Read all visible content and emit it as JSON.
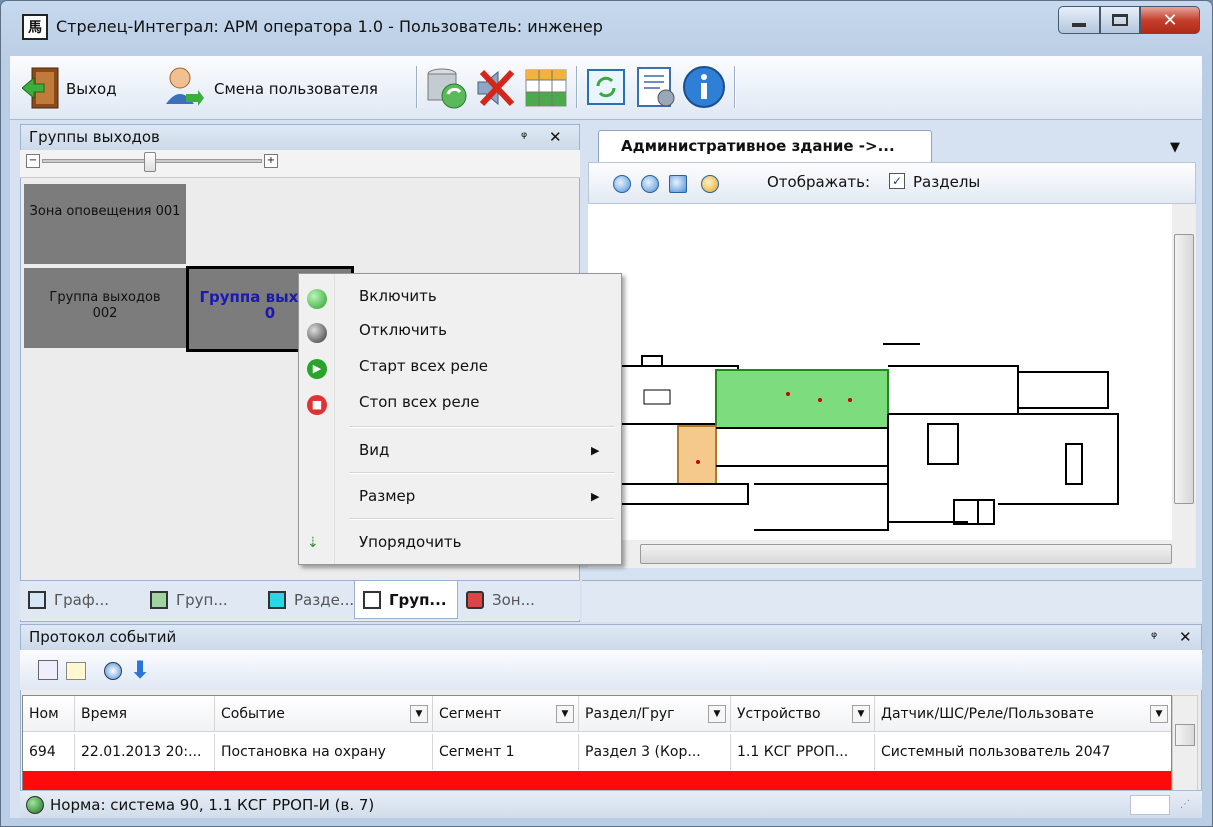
{
  "window": {
    "title": "Стрелец-Интеграл: АРМ оператора 1.0 - Пользователь: инженер",
    "app_icon": "strelets-app-icon"
  },
  "toolbar": {
    "exit_label": "Выход",
    "change_user_label": "Смена пользователя"
  },
  "left_panel": {
    "title": "Группы выходов",
    "tiles": [
      {
        "label": "Зона оповещения 001"
      },
      {
        "label": "Группа выходов 002"
      },
      {
        "label": "Группа выходов 0"
      }
    ],
    "tabs": [
      "Граф...",
      "Груп...",
      "Разде...",
      "Груп...",
      "Зон..."
    ],
    "active_tab": 3
  },
  "document": {
    "tab_title": "Административное здание ->...",
    "show_label": "Отображать:",
    "sections_label": "Разделы",
    "sections_checked": true
  },
  "context_menu": {
    "items": [
      {
        "label": "Включить",
        "icon": "green-circle-icon"
      },
      {
        "label": "Отключить",
        "icon": "gray-circle-icon"
      },
      {
        "label": "Старт всех реле",
        "icon": "play-icon"
      },
      {
        "label": "Стоп всех реле",
        "icon": "stop-icon"
      },
      {
        "label": "Вид",
        "submenu": true
      },
      {
        "label": "Размер",
        "submenu": true
      },
      {
        "label": "Упорядочить",
        "icon": "sort-icon"
      }
    ]
  },
  "events_panel": {
    "title": "Протокол событий",
    "columns": [
      "Ном",
      "Время",
      "Событие",
      "Сегмент",
      "Раздел/Груг",
      "Устройство",
      "Датчик/ШС/Реле/Пользовате"
    ],
    "rows": [
      [
        "694",
        "22.01.2013 20:...",
        "Постановка на охрану",
        "Сегмент 1",
        "Раздел 3 (Кор...",
        "1.1 КСГ РРОП...",
        "Системный пользователь 2047"
      ]
    ]
  },
  "status_bar": {
    "text": "Норма:  система 90, 1.1 КСГ РРОП-И (в. 7)"
  },
  "colors": {
    "alarm_row": "#ff0a0a",
    "zone_green": "#7ddc7d",
    "zone_orange": "#f5c98c"
  }
}
